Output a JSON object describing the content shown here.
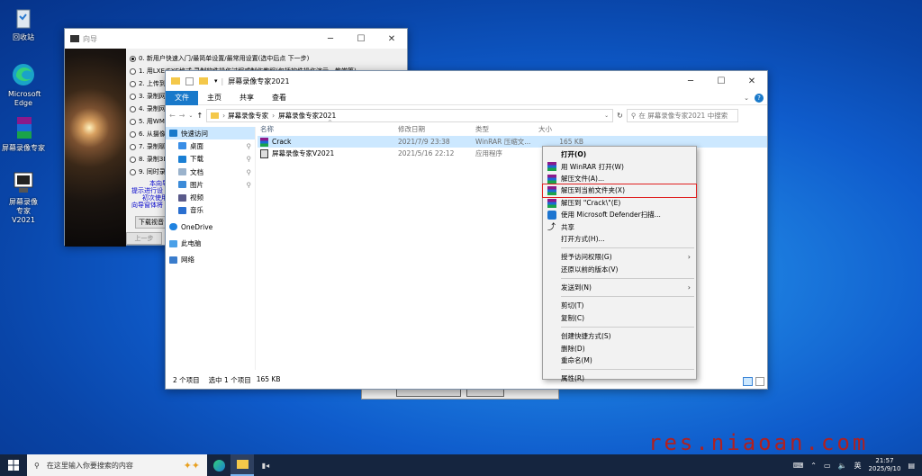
{
  "desktop": {
    "icons": [
      {
        "label": "回收站",
        "icon": "recycle-bin-icon"
      },
      {
        "label": "Microsoft Edge",
        "icon": "edge-icon"
      },
      {
        "label": "屏幕录像专家",
        "icon": "winrar-archive-icon"
      },
      {
        "label": "屏幕录像专家V2021",
        "icon": "app-icon"
      }
    ]
  },
  "wizard": {
    "title": "向导",
    "items": [
      "0. 新用户快速入门/最简单设置/最常用设置(选中后点 下一步)",
      "1. 用LXE/EXE格式 录制软件操作过程或制作教程(包括软件操作演示，教学等)",
      "2. 上传到",
      "3. 录制网",
      "4. 录制网",
      "5. 用WMV",
      "6. 从摄像",
      "7. 录制聊",
      "8. 录制3D",
      "9. 同时录"
    ],
    "blue_lines": [
      "本向导",
      "提示进行设",
      "初次使用",
      "向导窗体将"
    ],
    "download_btn": "下载视音",
    "prev_btn": "上一步"
  },
  "explorer": {
    "title": "屏幕录像专家2021",
    "tabs": [
      "文件",
      "主页",
      "共享",
      "查看"
    ],
    "path": [
      "屏幕录像专家",
      "屏幕录像专家2021"
    ],
    "search_placeholder": "在 屏幕录像专家2021 中搜索",
    "nav": [
      "快速访问",
      "桌面",
      "下载",
      "文档",
      "图片",
      "视频",
      "音乐",
      "OneDrive",
      "此电脑",
      "网络"
    ],
    "columns": [
      "名称",
      "修改日期",
      "类型",
      "大小"
    ],
    "files": [
      {
        "name": "Crack",
        "date": "2021/7/9 23:38",
        "type": "WinRAR 压缩文...",
        "size": "165 KB"
      },
      {
        "name": "屏幕录像专家V2021",
        "date": "2021/5/16 22:12",
        "type": "应用程序",
        "size": ""
      }
    ],
    "status": {
      "count": "2 个项目",
      "selected": "选中 1 个项目",
      "size": "165 KB"
    }
  },
  "context_menu": {
    "items": [
      "打开(O)",
      "用 WinRAR 打开(W)",
      "解压文件(A)...",
      "解压到当前文件夹(X)",
      "解压到 \"Crack\\\"(E)",
      "使用 Microsoft Defender扫描...",
      "共享",
      "打开方式(H)...",
      "授予访问权限(G)",
      "还原以前的版本(V)",
      "发送到(N)",
      "剪切(T)",
      "复制(C)",
      "创建快捷方式(S)",
      "删除(D)",
      "重命名(M)",
      "属性(R)"
    ]
  },
  "taskbar": {
    "search_placeholder": "在这里输入你要搜索的内容",
    "tray_lang": "英",
    "time": "21:57",
    "date": "2025/9/10"
  },
  "watermark": "res.niaoan.com",
  "colors": {
    "accent": "#1979ca",
    "selection": "#cce8ff",
    "highlight_box": "#e02020"
  }
}
